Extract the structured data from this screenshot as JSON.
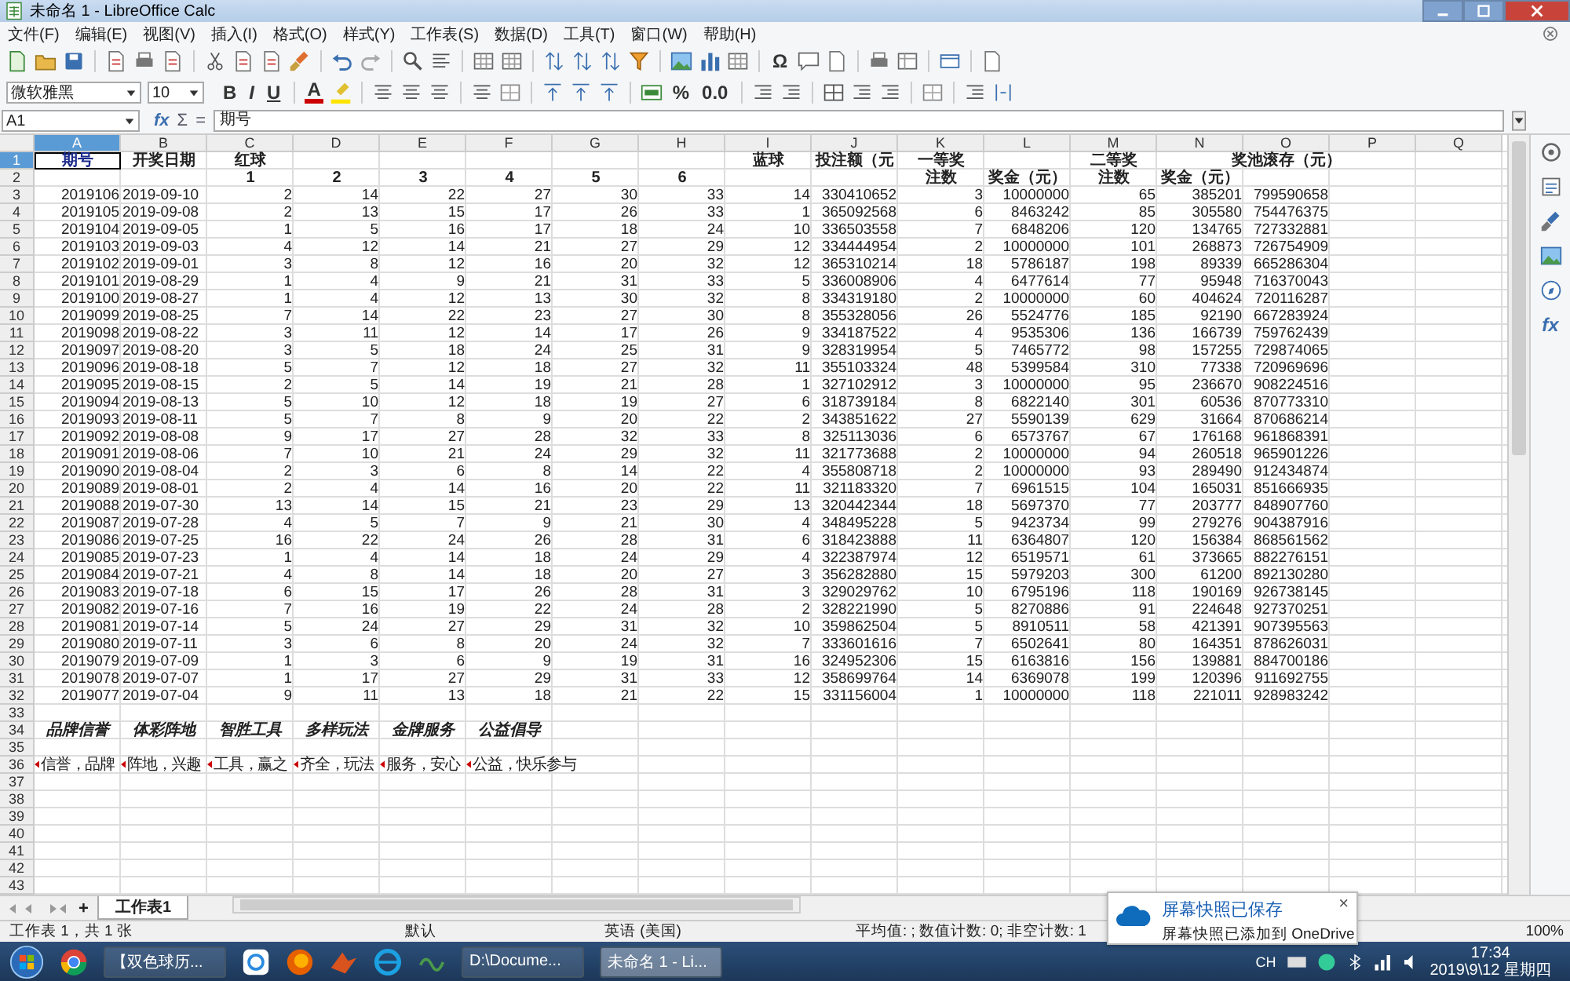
{
  "window": {
    "title": "未命名 1 - LibreOffice Calc"
  },
  "menu": [
    "文件(F)",
    "编辑(E)",
    "视图(V)",
    "插入(I)",
    "格式(O)",
    "样式(Y)",
    "工作表(S)",
    "数据(D)",
    "工具(T)",
    "窗口(W)",
    "帮助(H)"
  ],
  "toolbar": {
    "special_character": "Ω"
  },
  "format_bar": {
    "font": "微软雅黑",
    "size": "10",
    "style_buttons": [
      "B",
      "I",
      "U"
    ],
    "font_color": "A",
    "number_buttons": [
      "%",
      "0.0"
    ]
  },
  "formula_bar": {
    "name_box": "A1",
    "function_buttons": [
      "fx",
      "Σ",
      "="
    ],
    "content": "期号"
  },
  "sheet": {
    "columns": [
      {
        "label": "A",
        "selected": true
      },
      {
        "label": "B",
        "selected": false
      },
      {
        "label": "C",
        "selected": false
      },
      {
        "label": "D",
        "selected": false
      },
      {
        "label": "E",
        "selected": false
      },
      {
        "label": "F",
        "selected": false
      },
      {
        "label": "G",
        "selected": false
      },
      {
        "label": "H",
        "selected": false
      },
      {
        "label": "I",
        "selected": false
      },
      {
        "label": "J",
        "selected": false
      },
      {
        "label": "K",
        "selected": false
      },
      {
        "label": "L",
        "selected": false
      },
      {
        "label": "M",
        "selected": false
      },
      {
        "label": "N",
        "selected": false
      },
      {
        "label": "O",
        "selected": false
      },
      {
        "label": "P",
        "selected": false
      },
      {
        "label": "Q",
        "selected": false
      }
    ],
    "rows": [
      {
        "n": "1",
        "selected": true,
        "kind": "header",
        "cells": [
          "期号",
          "开奖日期",
          "红球",
          null,
          null,
          null,
          null,
          null,
          "蓝球",
          "投注额（元",
          "一等奖",
          null,
          "二等奖",
          null,
          "奖池滚存（元）"
        ]
      },
      {
        "n": "2",
        "selected": false,
        "kind": "header",
        "cells": [
          null,
          null,
          "1",
          "2",
          "3",
          "4",
          "5",
          "6",
          null,
          null,
          "注数",
          "奖金（元）",
          "注数",
          "奖金（元）"
        ]
      },
      {
        "n": "3",
        "selected": false,
        "kind": "data",
        "cells": [
          "2019106",
          "2019-09-10",
          "2",
          "14",
          "22",
          "27",
          "30",
          "33",
          "14",
          "330410652",
          "3",
          "10000000",
          "65",
          "385201",
          "799590658"
        ]
      },
      {
        "n": "4",
        "selected": false,
        "kind": "data",
        "cells": [
          "2019105",
          "2019-09-08",
          "2",
          "13",
          "15",
          "17",
          "26",
          "33",
          "1",
          "365092568",
          "6",
          "8463242",
          "85",
          "305580",
          "754476375"
        ]
      },
      {
        "n": "5",
        "selected": false,
        "kind": "data",
        "cells": [
          "2019104",
          "2019-09-05",
          "1",
          "5",
          "16",
          "17",
          "18",
          "24",
          "10",
          "336503558",
          "7",
          "6848206",
          "120",
          "134765",
          "727332881"
        ]
      },
      {
        "n": "6",
        "selected": false,
        "kind": "data",
        "cells": [
          "2019103",
          "2019-09-03",
          "4",
          "12",
          "14",
          "21",
          "27",
          "29",
          "12",
          "334444954",
          "2",
          "10000000",
          "101",
          "268873",
          "726754909"
        ]
      },
      {
        "n": "7",
        "selected": false,
        "kind": "data",
        "cells": [
          "2019102",
          "2019-09-01",
          "3",
          "8",
          "12",
          "16",
          "20",
          "32",
          "12",
          "365310214",
          "18",
          "5786187",
          "198",
          "89339",
          "665286304"
        ]
      },
      {
        "n": "8",
        "selected": false,
        "kind": "data",
        "cells": [
          "2019101",
          "2019-08-29",
          "1",
          "4",
          "9",
          "21",
          "31",
          "33",
          "5",
          "336008906",
          "4",
          "6477614",
          "77",
          "95948",
          "716370043"
        ]
      },
      {
        "n": "9",
        "selected": false,
        "kind": "data",
        "cells": [
          "2019100",
          "2019-08-27",
          "1",
          "4",
          "12",
          "13",
          "30",
          "32",
          "8",
          "334319180",
          "2",
          "10000000",
          "60",
          "404624",
          "720116287"
        ]
      },
      {
        "n": "10",
        "selected": false,
        "kind": "data",
        "cells": [
          "2019099",
          "2019-08-25",
          "7",
          "14",
          "22",
          "23",
          "27",
          "30",
          "8",
          "355328056",
          "26",
          "5524776",
          "185",
          "92190",
          "667283924"
        ]
      },
      {
        "n": "11",
        "selected": false,
        "kind": "data",
        "cells": [
          "2019098",
          "2019-08-22",
          "3",
          "11",
          "12",
          "14",
          "17",
          "26",
          "9",
          "334187522",
          "4",
          "9535306",
          "136",
          "166739",
          "759762439"
        ]
      },
      {
        "n": "12",
        "selected": false,
        "kind": "data",
        "cells": [
          "2019097",
          "2019-08-20",
          "3",
          "5",
          "18",
          "24",
          "25",
          "31",
          "9",
          "328319954",
          "5",
          "7465772",
          "98",
          "157255",
          "729874065"
        ]
      },
      {
        "n": "13",
        "selected": false,
        "kind": "data",
        "cells": [
          "2019096",
          "2019-08-18",
          "5",
          "7",
          "12",
          "18",
          "27",
          "32",
          "11",
          "355103324",
          "48",
          "5399584",
          "310",
          "77338",
          "720969696"
        ]
      },
      {
        "n": "14",
        "selected": false,
        "kind": "data",
        "cells": [
          "2019095",
          "2019-08-15",
          "2",
          "5",
          "14",
          "19",
          "21",
          "28",
          "1",
          "327102912",
          "3",
          "10000000",
          "95",
          "236670",
          "908224516"
        ]
      },
      {
        "n": "15",
        "selected": false,
        "kind": "data",
        "cells": [
          "2019094",
          "2019-08-13",
          "5",
          "10",
          "12",
          "18",
          "19",
          "27",
          "6",
          "318739184",
          "8",
          "6822140",
          "301",
          "60536",
          "870773310"
        ]
      },
      {
        "n": "16",
        "selected": false,
        "kind": "data",
        "cells": [
          "2019093",
          "2019-08-11",
          "5",
          "7",
          "8",
          "9",
          "20",
          "22",
          "2",
          "343851622",
          "27",
          "5590139",
          "629",
          "31664",
          "870686214"
        ]
      },
      {
        "n": "17",
        "selected": false,
        "kind": "data",
        "cells": [
          "2019092",
          "2019-08-08",
          "9",
          "17",
          "27",
          "28",
          "32",
          "33",
          "8",
          "325113036",
          "6",
          "6573767",
          "67",
          "176168",
          "961868391"
        ]
      },
      {
        "n": "18",
        "selected": false,
        "kind": "data",
        "cells": [
          "2019091",
          "2019-08-06",
          "7",
          "10",
          "21",
          "24",
          "29",
          "32",
          "11",
          "321773688",
          "2",
          "10000000",
          "94",
          "260518",
          "965901226"
        ]
      },
      {
        "n": "19",
        "selected": false,
        "kind": "data",
        "cells": [
          "2019090",
          "2019-08-04",
          "2",
          "3",
          "6",
          "8",
          "14",
          "22",
          "4",
          "355808718",
          "2",
          "10000000",
          "93",
          "289490",
          "912434874"
        ]
      },
      {
        "n": "20",
        "selected": false,
        "kind": "data",
        "cells": [
          "2019089",
          "2019-08-01",
          "2",
          "4",
          "14",
          "16",
          "20",
          "22",
          "11",
          "321183320",
          "7",
          "6961515",
          "104",
          "165031",
          "851666935"
        ]
      },
      {
        "n": "21",
        "selected": false,
        "kind": "data",
        "cells": [
          "2019088",
          "2019-07-30",
          "13",
          "14",
          "15",
          "21",
          "23",
          "29",
          "13",
          "320442344",
          "18",
          "5697370",
          "77",
          "203777",
          "848907760"
        ]
      },
      {
        "n": "22",
        "selected": false,
        "kind": "data",
        "cells": [
          "2019087",
          "2019-07-28",
          "4",
          "5",
          "7",
          "9",
          "21",
          "30",
          "4",
          "348495228",
          "5",
          "9423734",
          "99",
          "279276",
          "904387916"
        ]
      },
      {
        "n": "23",
        "selected": false,
        "kind": "data",
        "cells": [
          "2019086",
          "2019-07-25",
          "16",
          "22",
          "24",
          "26",
          "28",
          "31",
          "6",
          "318423888",
          "11",
          "6364807",
          "120",
          "156384",
          "868561562"
        ]
      },
      {
        "n": "24",
        "selected": false,
        "kind": "data",
        "cells": [
          "2019085",
          "2019-07-23",
          "1",
          "4",
          "14",
          "18",
          "24",
          "29",
          "4",
          "322387974",
          "12",
          "6519571",
          "61",
          "373665",
          "882276151"
        ]
      },
      {
        "n": "25",
        "selected": false,
        "kind": "data",
        "cells": [
          "2019084",
          "2019-07-21",
          "4",
          "8",
          "14",
          "18",
          "20",
          "27",
          "3",
          "356282880",
          "15",
          "5979203",
          "300",
          "61200",
          "892130280"
        ]
      },
      {
        "n": "26",
        "selected": false,
        "kind": "data",
        "cells": [
          "2019083",
          "2019-07-18",
          "6",
          "15",
          "17",
          "26",
          "28",
          "31",
          "3",
          "329029762",
          "10",
          "6795196",
          "118",
          "190169",
          "926738145"
        ]
      },
      {
        "n": "27",
        "selected": false,
        "kind": "data",
        "cells": [
          "2019082",
          "2019-07-16",
          "7",
          "16",
          "19",
          "22",
          "24",
          "28",
          "2",
          "328221990",
          "5",
          "8270886",
          "91",
          "224648",
          "927370251"
        ]
      },
      {
        "n": "28",
        "selected": false,
        "kind": "data",
        "cells": [
          "2019081",
          "2019-07-14",
          "5",
          "24",
          "27",
          "29",
          "31",
          "32",
          "10",
          "359862504",
          "5",
          "8910511",
          "58",
          "421391",
          "907395563"
        ]
      },
      {
        "n": "29",
        "selected": false,
        "kind": "data",
        "cells": [
          "2019080",
          "2019-07-11",
          "3",
          "6",
          "8",
          "20",
          "24",
          "32",
          "7",
          "333601616",
          "7",
          "6502641",
          "80",
          "164351",
          "878626031"
        ]
      },
      {
        "n": "30",
        "selected": false,
        "kind": "data",
        "cells": [
          "2019079",
          "2019-07-09",
          "1",
          "3",
          "6",
          "9",
          "19",
          "31",
          "16",
          "324952306",
          "15",
          "6163816",
          "156",
          "139881",
          "884700186"
        ]
      },
      {
        "n": "31",
        "selected": false,
        "kind": "data",
        "cells": [
          "2019078",
          "2019-07-07",
          "1",
          "17",
          "27",
          "29",
          "31",
          "33",
          "12",
          "358699764",
          "14",
          "6369078",
          "199",
          "120396",
          "911692755"
        ]
      },
      {
        "n": "32",
        "selected": false,
        "kind": "data",
        "cells": [
          "2019077",
          "2019-07-04",
          "9",
          "11",
          "13",
          "18",
          "21",
          "22",
          "15",
          "331156004",
          "1",
          "10000000",
          "118",
          "221011",
          "928983242"
        ]
      },
      {
        "n": "33",
        "selected": false,
        "kind": "empty",
        "cells": []
      },
      {
        "n": "34",
        "selected": false,
        "kind": "label",
        "cells": [
          "品牌信誉",
          "体彩阵地",
          "智胜工具",
          "多样玩法",
          "金牌服务",
          "公益倡导"
        ]
      },
      {
        "n": "35",
        "selected": false,
        "kind": "empty",
        "cells": []
      },
      {
        "n": "36",
        "selected": false,
        "kind": "clipped",
        "cells": [
          "信誉，品牌",
          "阵地，兴趣",
          "工具，赢之",
          "齐全，玩法",
          "服务，安心",
          "公益，快乐参与"
        ]
      },
      {
        "n": "37",
        "selected": false,
        "kind": "empty",
        "cells": []
      },
      {
        "n": "38",
        "selected": false,
        "kind": "empty",
        "cells": []
      },
      {
        "n": "39",
        "selected": false,
        "kind": "empty",
        "cells": []
      },
      {
        "n": "40",
        "selected": false,
        "kind": "empty",
        "cells": []
      },
      {
        "n": "41",
        "selected": false,
        "kind": "empty",
        "cells": []
      },
      {
        "n": "42",
        "selected": false,
        "kind": "empty",
        "cells": []
      },
      {
        "n": "43",
        "selected": false,
        "kind": "empty",
        "cells": []
      }
    ]
  },
  "sidebar": {
    "function_button": "fx"
  },
  "sheet_tabs": {
    "add": "+",
    "tabs": [
      {
        "label": "工作表1",
        "selected": true
      }
    ]
  },
  "status_bar": {
    "sheet": "工作表 1，共 1 张",
    "style": "默认",
    "language": "英语 (美国)",
    "summary": "平均值: ; 数值计数: 0; 非空计数: 1",
    "zoom": "100%"
  },
  "notification": {
    "title": "屏幕快照已保存",
    "body": "屏幕快照已添加到 OneDrive",
    "close": "×"
  },
  "taskbar": {
    "tasks": [
      {
        "label": "【双色球历...",
        "selected": false
      },
      {
        "label": "D:\\Docume...",
        "selected": false
      },
      {
        "label": "未命名 1 - Li...",
        "selected": true
      }
    ],
    "language": "CH",
    "time": "17:34",
    "date": "2019\\9\\12 星期四"
  }
}
